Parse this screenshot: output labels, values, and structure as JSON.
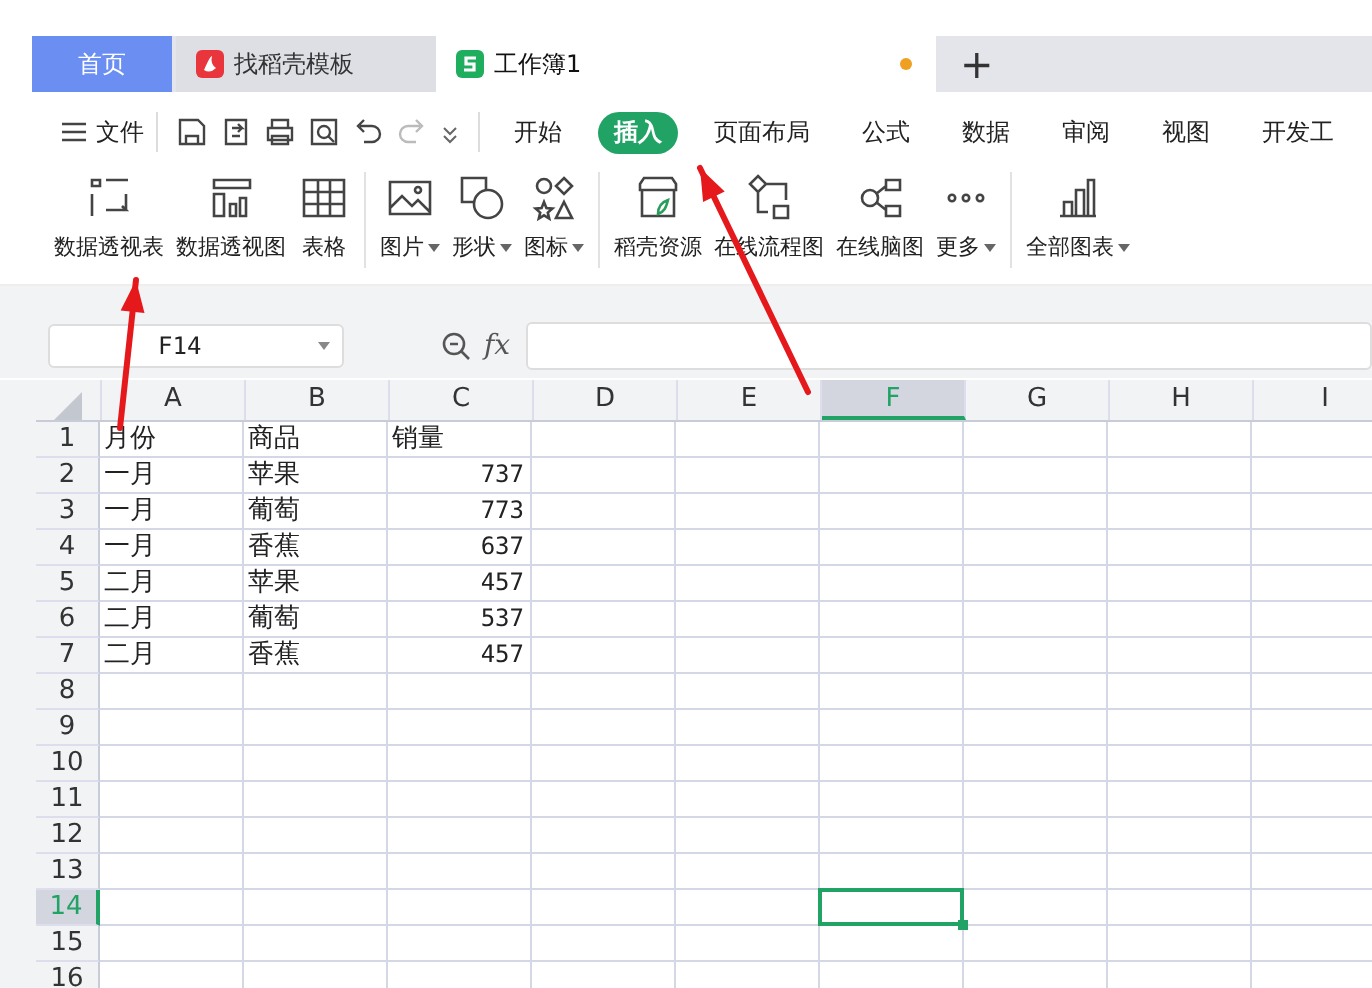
{
  "tabs": [
    {
      "label": "首页",
      "kind": "home",
      "selected": false
    },
    {
      "label": "找稻壳模板",
      "kind": "docer",
      "selected": false
    },
    {
      "label": "工作簿1",
      "kind": "sheet",
      "selected": true,
      "unsaved": true
    }
  ],
  "new_tab": "+",
  "file_menu": "文件",
  "ribbon_tabs": [
    {
      "label": "开始",
      "selected": false
    },
    {
      "label": "插入",
      "selected": true
    },
    {
      "label": "页面布局",
      "selected": false
    },
    {
      "label": "公式",
      "selected": false
    },
    {
      "label": "数据",
      "selected": false
    },
    {
      "label": "审阅",
      "selected": false
    },
    {
      "label": "视图",
      "selected": false
    },
    {
      "label": "开发工",
      "selected": false
    }
  ],
  "ribbon_groups": [
    [
      {
        "label": "数据透视表",
        "dropdown": false
      },
      {
        "label": "数据透视图",
        "dropdown": false
      },
      {
        "label": "表格",
        "dropdown": false
      }
    ],
    [
      {
        "label": "图片",
        "dropdown": true
      },
      {
        "label": "形状",
        "dropdown": true
      },
      {
        "label": "图标",
        "dropdown": true
      }
    ],
    [
      {
        "label": "稻壳资源",
        "dropdown": false
      },
      {
        "label": "在线流程图",
        "dropdown": false
      },
      {
        "label": "在线脑图",
        "dropdown": false
      },
      {
        "label": "更多",
        "dropdown": true
      }
    ],
    [
      {
        "label": "全部图表",
        "dropdown": true
      }
    ]
  ],
  "name_box": "F14",
  "fx": "fx",
  "columns": [
    {
      "label": "A",
      "selected": false
    },
    {
      "label": "B",
      "selected": false
    },
    {
      "label": "C",
      "selected": false
    },
    {
      "label": "D",
      "selected": false
    },
    {
      "label": "E",
      "selected": false
    },
    {
      "label": "F",
      "selected": true
    },
    {
      "label": "G",
      "selected": false
    },
    {
      "label": "H",
      "selected": false
    },
    {
      "label": "I",
      "selected": false
    }
  ],
  "rows": [
    {
      "number": "1",
      "selected": false,
      "cells": [
        "月份",
        "商品",
        "销量"
      ]
    },
    {
      "number": "2",
      "selected": false,
      "cells": [
        "一月",
        "苹果",
        "737"
      ]
    },
    {
      "number": "3",
      "selected": false,
      "cells": [
        "一月",
        "葡萄",
        "773"
      ]
    },
    {
      "number": "4",
      "selected": false,
      "cells": [
        "一月",
        "香蕉",
        "637"
      ]
    },
    {
      "number": "5",
      "selected": false,
      "cells": [
        "二月",
        "苹果",
        "457"
      ]
    },
    {
      "number": "6",
      "selected": false,
      "cells": [
        "二月",
        "葡萄",
        "537"
      ]
    },
    {
      "number": "7",
      "selected": false,
      "cells": [
        "二月",
        "香蕉",
        "457"
      ]
    },
    {
      "number": "8",
      "selected": false,
      "cells": []
    },
    {
      "number": "9",
      "selected": false,
      "cells": []
    },
    {
      "number": "10",
      "selected": false,
      "cells": []
    },
    {
      "number": "11",
      "selected": false,
      "cells": []
    },
    {
      "number": "12",
      "selected": false,
      "cells": []
    },
    {
      "number": "13",
      "selected": false,
      "cells": []
    },
    {
      "number": "14",
      "selected": true,
      "cells": []
    },
    {
      "number": "15",
      "selected": false,
      "cells": []
    },
    {
      "number": "16",
      "selected": false,
      "cells": []
    }
  ],
  "annotations": [
    {
      "kind": "arrow"
    },
    {
      "kind": "arrow"
    }
  ]
}
